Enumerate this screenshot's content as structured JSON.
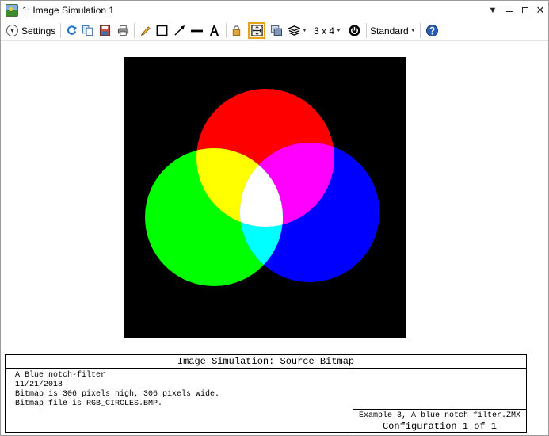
{
  "window": {
    "title": "1: Image Simulation 1"
  },
  "toolbar": {
    "settings_label": "Settings",
    "layout_label": "3 x 4",
    "style_label": "Standard"
  },
  "icons": {
    "app": "image-simulation-icon",
    "settings": "chevron-down-circle-icon",
    "refresh": "refresh-icon",
    "copy": "copy-icon",
    "save": "save-icon",
    "print": "print-icon",
    "pencil": "pencil-icon",
    "rectangle": "rectangle-icon",
    "arrow": "arrow-icon",
    "line": "line-icon",
    "text": "text-icon",
    "lock": "lock-icon",
    "fit": "fit-to-window-icon",
    "window": "new-window-icon",
    "layers": "layers-icon",
    "power": "power-icon",
    "help": "help-icon"
  },
  "colors": {
    "active_tool_border": "#e7a21a",
    "help_blue": "#2a5cb8",
    "red_circle": "#ff0000",
    "green_circle": "#00ff00",
    "blue_circle": "#0000ff"
  },
  "info": {
    "title": "Image Simulation: Source Bitmap",
    "lines": [
      "A Blue notch-filter",
      "11/21/2018",
      "Bitmap is 306 pixels high, 306 pixels wide.",
      "Bitmap file is RGB_CIRCLES.BMP."
    ],
    "file": "Example 3, A blue notch filter.ZMX",
    "configuration": "Configuration 1 of 1"
  }
}
